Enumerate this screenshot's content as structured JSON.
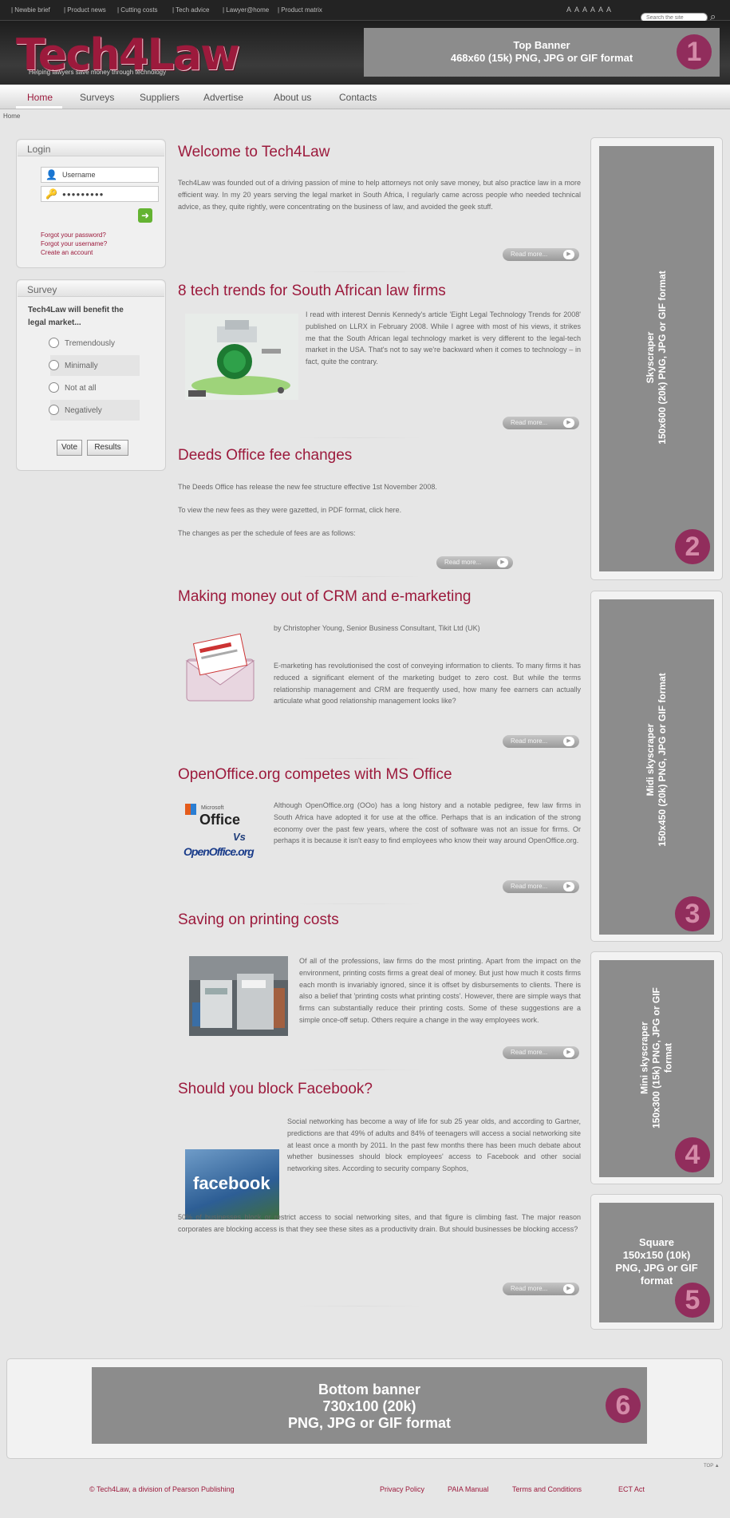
{
  "topbar": {
    "links": [
      "| Newbie brief",
      "| Product news",
      "| Cutting costs",
      "| Tech advice",
      "| Lawyer@home",
      "| Product matrix"
    ],
    "font_sizes": [
      "A",
      "A",
      "A",
      "A",
      "A",
      "A"
    ],
    "search_placeholder": "Search the site"
  },
  "header": {
    "logo": "Tech4Law",
    "tagline": "Helping lawyers save money through technology",
    "top_banner": {
      "line1": "Top Banner",
      "line2": "468x60 (15k) PNG, JPG or GIF format",
      "number": "1"
    }
  },
  "nav": {
    "items": [
      "Home",
      "Surveys",
      "Suppliers",
      "Advertise",
      "About us",
      "Contacts"
    ]
  },
  "breadcrumb": "Home",
  "login": {
    "title": "Login",
    "username_value": "Username",
    "password_value": "●●●●●●●●●",
    "links": [
      "Forgot your password?",
      "Forgot your username?",
      "Create an account"
    ]
  },
  "survey": {
    "title": "Survey",
    "question": "Tech4Law will benefit the legal market...",
    "options": [
      "Tremendously",
      "Minimally",
      "Not at all",
      "Negatively"
    ],
    "vote_label": "Vote",
    "results_label": "Results"
  },
  "articles": [
    {
      "title": "Welcome to Tech4Law",
      "body": "Tech4Law was founded out of a driving passion of mine to help attorneys not only save money, but also practice law in a more efficient way. In my 20 years serving the legal market in South Africa, I regularly came across people who needed technical advice, as they, quite rightly, were concentrating on the business of law, and avoided the geek stuff.",
      "read_more": "Read more..."
    },
    {
      "title": "8 tech trends for South African law firms",
      "body": "I read with interest Dennis Kennedy's article 'Eight Legal Technology Trends for 2008' published on LLRX in February 2008. While I agree with most of his views, it strikes me that the South African legal technology market is very different to the legal-tech market in the USA. That's not to say we're backward when it comes to technology – in fact, quite the contrary.",
      "read_more": "Read more..."
    },
    {
      "title": "Deeds Office fee changes",
      "p1": "The Deeds Office has release the new fee structure effective 1st November 2008.",
      "p2": "To view the new fees as they were gazetted, in PDF format, click here.",
      "p3": "The changes as per the schedule of fees are as follows:",
      "read_more": "Read more..."
    },
    {
      "title": "Making money out of CRM and e-marketing",
      "byline": "by Christopher Young, Senior Business Consultant, Tikit Ltd (UK)",
      "body": "E-marketing has revolutionised the cost of conveying information to clients. To many firms it has reduced a significant element of the marketing budget to zero cost. But while the terms relationship management and CRM are frequently used, how many fee earners can actually articulate what good relationship management looks like?",
      "read_more": "Read more..."
    },
    {
      "title": "OpenOffice.org competes with MS Office",
      "body": "Although OpenOffice.org (OOo) has a long history and a notable pedigree, few law firms in South Africa have adopted it for use at the office. Perhaps that is an indication of the strong economy over the past few years, where the cost of software was not an issue for firms. Or perhaps it is because it isn't easy to find employees who know their way around OpenOffice.org.",
      "logo_ms": "Microsoft",
      "logo_office": "Office",
      "logo_vs": "Vs",
      "logo_oo": "OpenOffice.org",
      "read_more": "Read more..."
    },
    {
      "title": "Saving on printing costs",
      "body": "Of all of the professions, law firms do the most printing. Apart from the impact on the environment, printing costs firms a great deal of money. But just how much it costs firms each month is invariably ignored, since it is offset by disbursements to clients. There is also a belief that 'printing costs what printing costs'. However, there are simple ways that firms can substantially reduce their printing costs. Some of these suggestions are a simple once-off setup. Others require a change in the way employees work.",
      "read_more": "Read more..."
    },
    {
      "title": "Should you block Facebook?",
      "body": "Social networking has become a way of life for sub 25 year olds, and according to Gartner, predictions are that 49% of adults and 84% of teenagers will access a social networking site at least once a month by 2011. In the past few months there has been much debate about whether businesses should block employees' access to Facebook and other social networking sites. According to security company Sophos, 50% of businesses block or restrict access to social networking sites, and that figure is climbing fast. The major reason corporates are blocking access is that they see these sites as a productivity drain. But should businesses be blocking access?",
      "thumb_text": "facebook",
      "read_more": "Read more..."
    }
  ],
  "ads": {
    "skyscraper": {
      "line1": "Skyscraper",
      "line2": "150x600 (20k) PNG, JPG or GIF format",
      "number": "2"
    },
    "midi": {
      "line1": "Midi skyscraper",
      "line2": "150x450 (20k) PNG, JPG or GIF format",
      "number": "3"
    },
    "mini": {
      "line1": "Mini skyscraper",
      "line2": "150x300 (15k) PNG, JPG or GIF",
      "line3": "format",
      "number": "4"
    },
    "square": {
      "line1": "Square",
      "line2": "150x150 (10k)",
      "line3": "PNG, JPG or GIF",
      "line4": "format",
      "number": "5"
    },
    "bottom": {
      "line1": "Bottom banner",
      "line2": "730x100 (20k)",
      "line3": "PNG, JPG or GIF format",
      "number": "6"
    }
  },
  "footer": {
    "top_link": "TOP ▲",
    "copyright": "© Tech4Law, a division of Pearson Publishing",
    "links": [
      "Privacy Policy",
      "PAIA Manual",
      "Terms and Conditions",
      "ECT Act"
    ]
  },
  "colors": {
    "accent": "#9c1a3c",
    "ad_grey": "#8c8c8c",
    "badge": "#912d5c"
  }
}
